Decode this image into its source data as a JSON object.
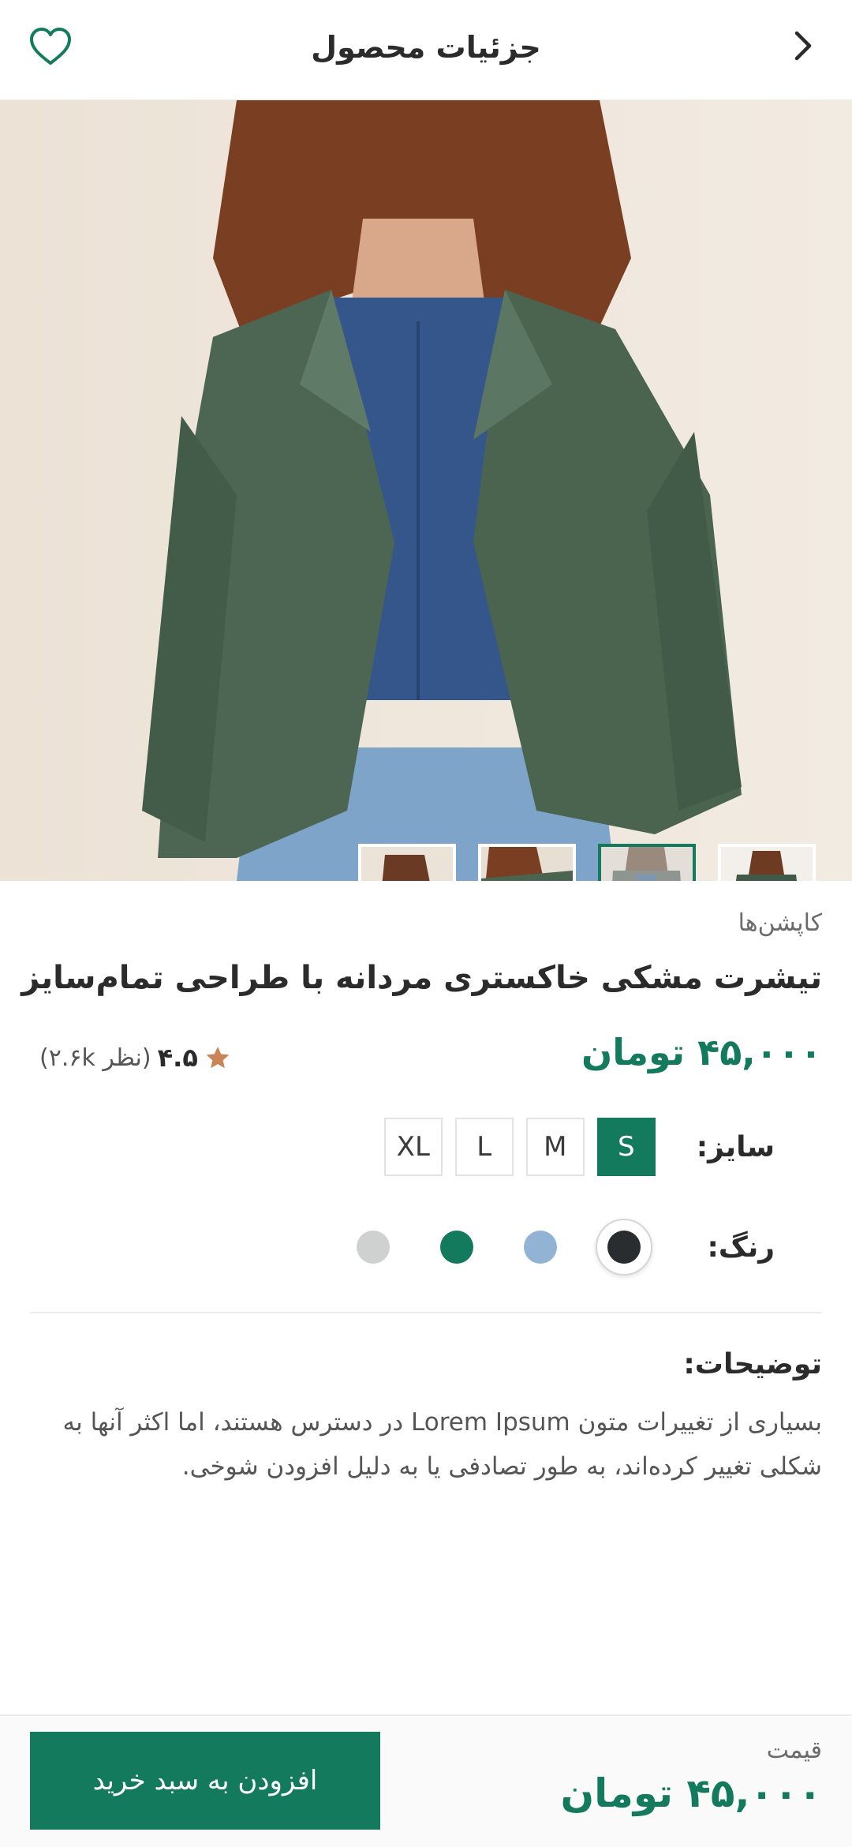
{
  "header": {
    "title": "جزئیات محصول"
  },
  "gallery": {
    "thumbnails": [
      "thumb-1",
      "thumb-2",
      "thumb-3",
      "thumb-4"
    ],
    "active_index": 2
  },
  "product": {
    "category": "کاپشن‌ها",
    "title": "تیشرت مشکی خاکستری مردانه با طراحی تمام‌سایز",
    "price": "۴۵,۰۰۰ تومان",
    "rating_score": "۴.۵",
    "rating_count": "(۲.۶k نظر)"
  },
  "size": {
    "label": "سایز:",
    "options": [
      "S",
      "M",
      "L",
      "XL"
    ],
    "selected": "S"
  },
  "color": {
    "label": "رنگ:",
    "options": [
      "#2a2d2f",
      "#93b3d4",
      "#137a5e",
      "#cfd1d1"
    ],
    "selected": "#2a2d2f"
  },
  "description": {
    "title": "توضیحات:",
    "text": "بسیاری از تغییرات متون Lorem Ipsum در دسترس هستند، اما اکثر آنها به شکلی تغییر کرده‌اند، به طور تصادفی یا به دلیل افزودن شوخی."
  },
  "bottom_bar": {
    "price_label": "قیمت",
    "price_value": "۴۵,۰۰۰ تومان",
    "cart_button": "افزودن به سبد خرید"
  },
  "colors": {
    "accent": "#137a5e",
    "star": "#c98457"
  }
}
